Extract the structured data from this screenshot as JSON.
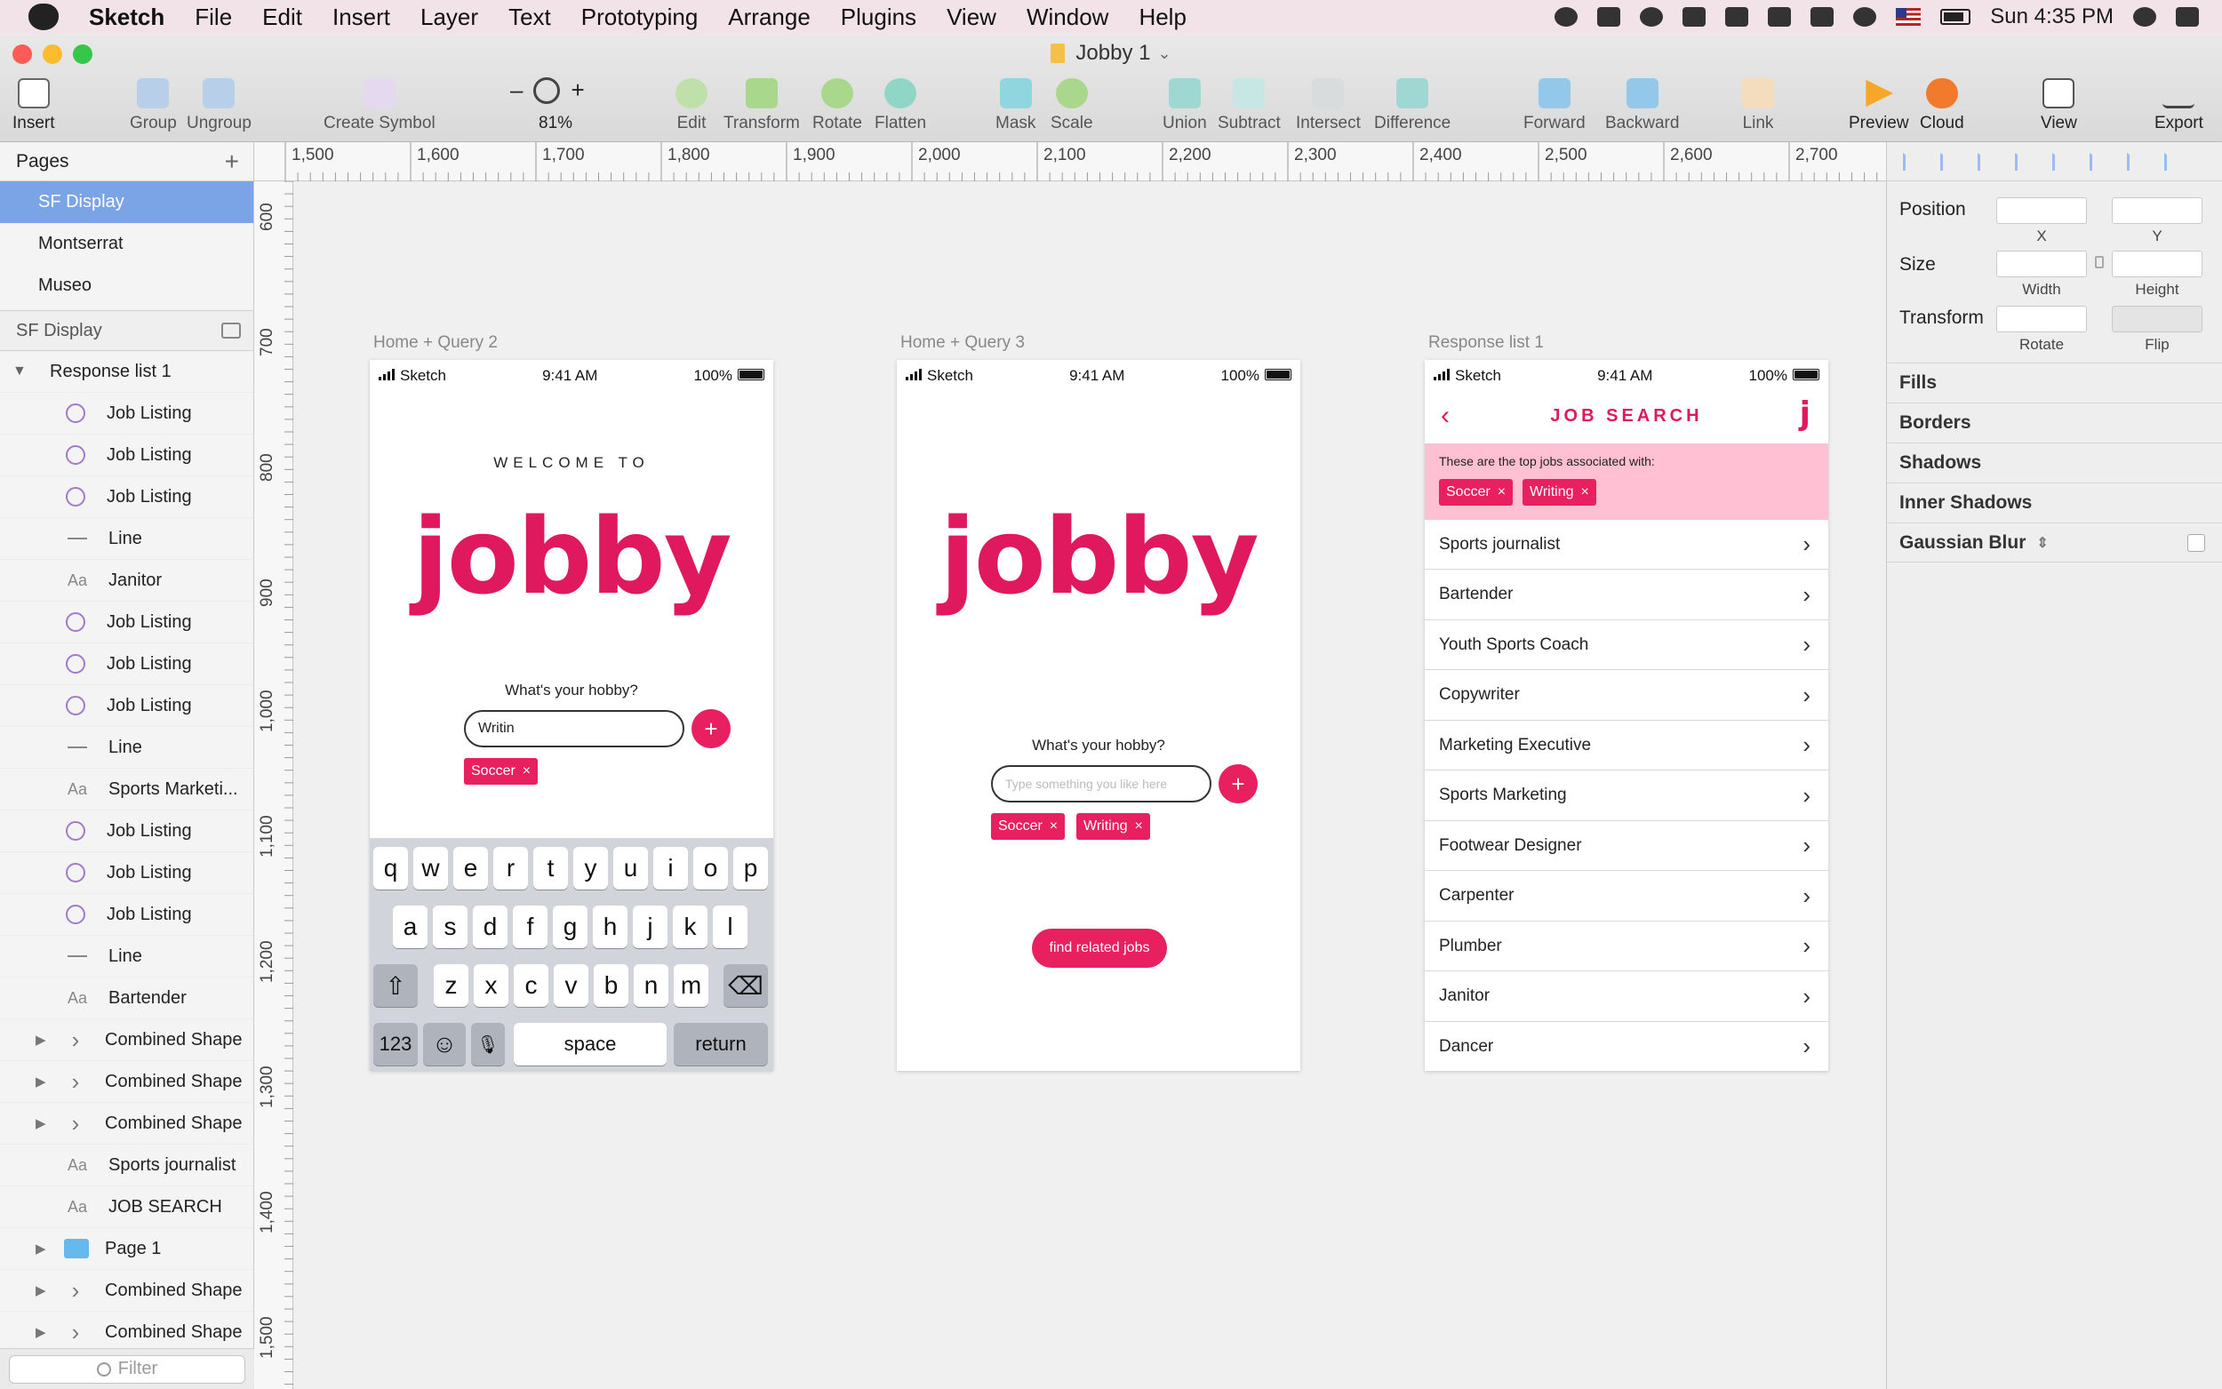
{
  "menubar": {
    "app": "Sketch",
    "items": [
      "File",
      "Edit",
      "Insert",
      "Layer",
      "Text",
      "Prototyping",
      "Arrange",
      "Plugins",
      "View",
      "Window",
      "Help"
    ],
    "clock": "Sun 4:35 PM"
  },
  "window": {
    "title": "Jobby 1"
  },
  "toolbar": {
    "insert": "Insert",
    "group": "Group",
    "ungroup": "Ungroup",
    "create_symbol": "Create Symbol",
    "zoom_minus": "–",
    "zoom_plus": "+",
    "zoom_level": "81%",
    "edit": "Edit",
    "transform": "Transform",
    "rotate": "Rotate",
    "flatten": "Flatten",
    "mask": "Mask",
    "scale": "Scale",
    "union": "Union",
    "subtract": "Subtract",
    "intersect": "Intersect",
    "difference": "Difference",
    "forward": "Forward",
    "backward": "Backward",
    "link": "Link",
    "preview": "Preview",
    "cloud": "Cloud",
    "view": "View",
    "export": "Export"
  },
  "sidebar": {
    "pages_title": "Pages",
    "pages": [
      "SF Display",
      "Montserrat",
      "Museo"
    ],
    "current_page": "SF Display",
    "artboard_group": "Response list 1",
    "layers": [
      {
        "name": "Job Listing",
        "kind": "symbol"
      },
      {
        "name": "Job Listing",
        "kind": "symbol"
      },
      {
        "name": "Job Listing",
        "kind": "symbol"
      },
      {
        "name": "Line",
        "kind": "line"
      },
      {
        "name": "Janitor",
        "kind": "text"
      },
      {
        "name": "Job Listing",
        "kind": "symbol"
      },
      {
        "name": "Job Listing",
        "kind": "symbol"
      },
      {
        "name": "Job Listing",
        "kind": "symbol"
      },
      {
        "name": "Line",
        "kind": "line"
      },
      {
        "name": "Sports Marketi...",
        "kind": "text"
      },
      {
        "name": "Job Listing",
        "kind": "symbol"
      },
      {
        "name": "Job Listing",
        "kind": "symbol"
      },
      {
        "name": "Job Listing",
        "kind": "symbol"
      },
      {
        "name": "Line",
        "kind": "line"
      },
      {
        "name": "Bartender",
        "kind": "text"
      },
      {
        "name": "Combined Shape",
        "kind": "shape"
      },
      {
        "name": "Combined Shape",
        "kind": "shape"
      },
      {
        "name": "Combined Shape",
        "kind": "shape"
      },
      {
        "name": "Sports journalist",
        "kind": "text"
      },
      {
        "name": "JOB SEARCH",
        "kind": "text"
      },
      {
        "name": "Page 1",
        "kind": "folder"
      },
      {
        "name": "Combined Shape",
        "kind": "shape"
      },
      {
        "name": "Combined Shape",
        "kind": "shape"
      }
    ],
    "filter_placeholder": "Filter"
  },
  "rulers": {
    "top": [
      "1,500",
      "1,600",
      "1,700",
      "1,800",
      "1,900",
      "2,000",
      "2,100",
      "2,200",
      "2,300",
      "2,400",
      "2,500",
      "2,600",
      "2,700"
    ],
    "left": [
      "600",
      "700",
      "800",
      "900",
      "1,000",
      "1,100",
      "1,200",
      "1,300",
      "1,400",
      "1,500"
    ]
  },
  "artboards": {
    "a1": {
      "label": "Home + Query 2",
      "carrier": "Sketch",
      "time": "9:41 AM",
      "battery": "100%",
      "welcome": "WELCOME TO",
      "logo": "jobby",
      "question": "What's your hobby?",
      "input_value": "Writin",
      "tags": [
        "Soccer"
      ],
      "keyboard": {
        "row1": [
          "q",
          "w",
          "e",
          "r",
          "t",
          "y",
          "u",
          "i",
          "o",
          "p"
        ],
        "row2": [
          "a",
          "s",
          "d",
          "f",
          "g",
          "h",
          "j",
          "k",
          "l"
        ],
        "row3": [
          "z",
          "x",
          "c",
          "v",
          "b",
          "n",
          "m"
        ],
        "numbers": "123",
        "space": "space",
        "return": "return"
      }
    },
    "a2": {
      "label": "Home + Query 3",
      "carrier": "Sketch",
      "time": "9:41 AM",
      "battery": "100%",
      "logo": "jobby",
      "question": "What's your hobby?",
      "input_placeholder": "Type something you like here",
      "tags": [
        "Soccer",
        "Writing"
      ],
      "find_button": "find related jobs"
    },
    "a3": {
      "label": "Response list 1",
      "carrier": "Sketch",
      "time": "9:41 AM",
      "battery": "100%",
      "title": "JOB SEARCH",
      "mark": "j",
      "banner_text": "These are the top jobs associated with:",
      "tags": [
        "Soccer",
        "Writing"
      ],
      "jobs": [
        "Sports journalist",
        "Bartender",
        "Youth Sports Coach",
        "Copywriter",
        "Marketing Executive",
        "Sports Marketing",
        "Footwear Designer",
        "Carpenter",
        "Plumber",
        "Janitor",
        "Dancer"
      ]
    }
  },
  "inspector": {
    "position": "Position",
    "x": "X",
    "y": "Y",
    "size": "Size",
    "width": "Width",
    "height": "Height",
    "transform": "Transform",
    "rotate": "Rotate",
    "flip": "Flip",
    "sections": [
      "Fills",
      "Borders",
      "Shadows",
      "Inner Shadows",
      "Gaussian Blur"
    ]
  },
  "colors": {
    "brand_pink": "#e8205f",
    "banner_pink": "#ffc0d3",
    "selection_blue": "#7aa4e6"
  }
}
